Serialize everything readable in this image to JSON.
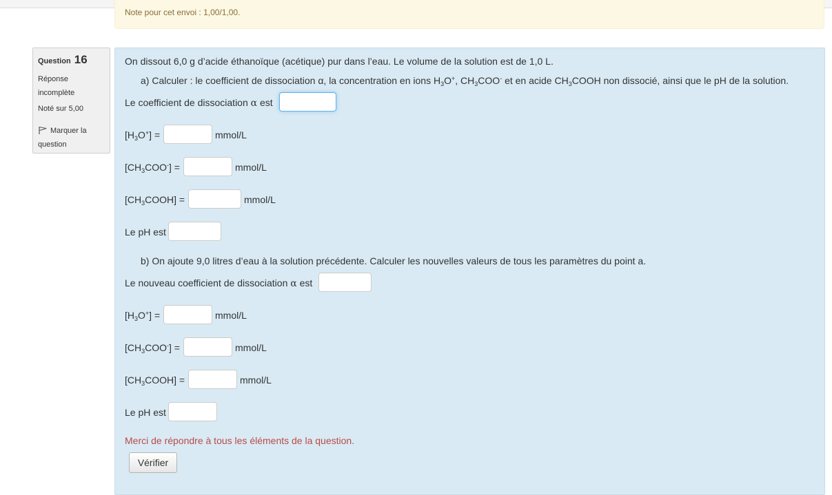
{
  "previous_feedback": {
    "grade_text": "Note pour cet envoi : 1,00/1,00."
  },
  "question_info": {
    "label": "Question",
    "number": "16",
    "state": "Réponse incomplète",
    "grade": "Noté sur 5,00",
    "flag_label": "Marquer la question"
  },
  "question": {
    "intro": "On dissout 6,0 g d’acide éthanoïque (acétique) pur dans l’eau. Le volume de la solution est  de 1,0 L.",
    "part_a": {
      "prompt_prefix": "a) Calculer : le coefficient de dissociation α, la concentration en ions ",
      "prompt_sep": ", ",
      "prompt_mid": " et en acide ",
      "prompt_suffix": " non dissocié, ainsi que le pH de la solution.",
      "alpha_label": "Le coefficient de dissociation ",
      "alpha_sym": "α",
      "alpha_suffix": " est",
      "h3o_label": "] =",
      "acetate_label": "] =",
      "acid_label": "[CH₃COOH] =",
      "ph_label": "Le pH est",
      "unit": "mmol/L",
      "alpha_value": "",
      "h3o_value": "",
      "acetate_value": "",
      "acid_value": "",
      "ph_value": ""
    },
    "part_b": {
      "prompt": "b) On ajoute 9,0 litres d’eau à la solution précédente. Calculer les nouvelles valeurs de tous les paramètres du point a.",
      "alpha_label": "Le nouveau coefficient de dissociation ",
      "alpha_sym": "α",
      "alpha_suffix": " est",
      "h3o_label": "] =",
      "acetate_label": "] =",
      "acid_label": "[CH₃COOH] =",
      "ph_label": "Le pH est",
      "unit": "mmol/L",
      "alpha_value": "",
      "h3o_value": "",
      "acetate_value": "",
      "acid_value": "",
      "ph_value": ""
    },
    "validation_error": "Merci de répondre à tous les éléments de la question.",
    "check_button": "Vérifier"
  },
  "colors": {
    "formulation_bg": "#d9eaf4",
    "info_bg": "#f0f0f0",
    "feedback_bg": "#fcf8e3",
    "error_text": "#b94a48",
    "focus_border": "#66afe9"
  }
}
